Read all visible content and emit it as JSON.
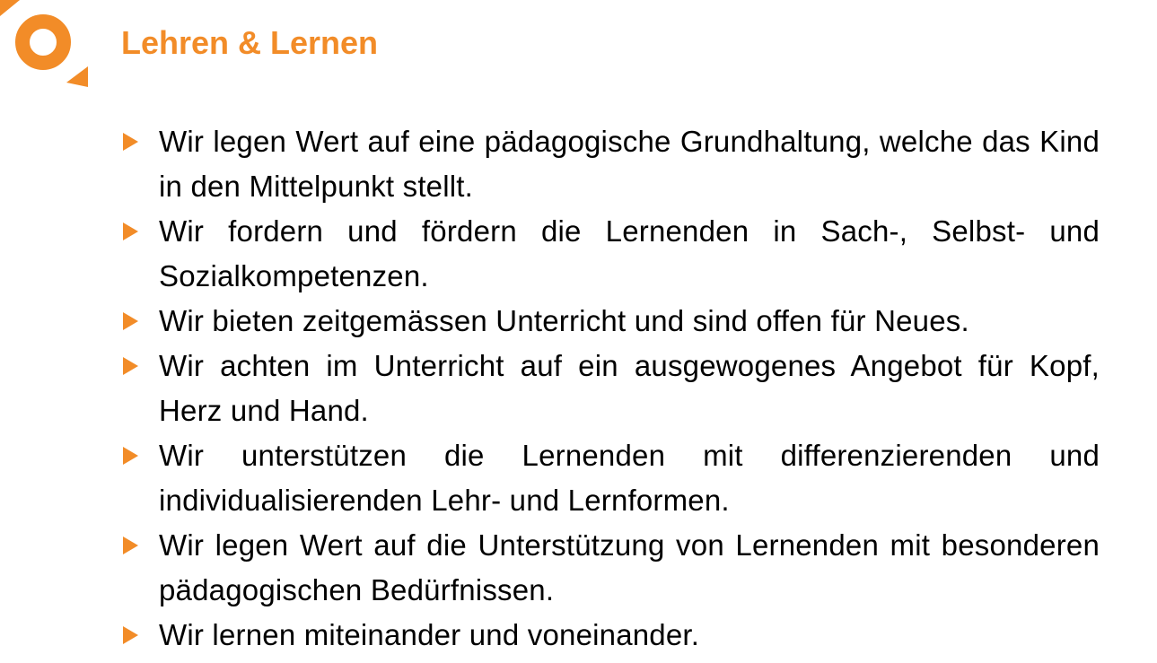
{
  "page": {
    "title": "Lehren & Lernen"
  },
  "logo": {
    "icon": "sun-ring-logo-icon",
    "color": "#f28c28"
  },
  "bullets": [
    {
      "text": "Wir legen Wert auf eine pädagogische Grundhaltung, welche das Kind in den Mittelpunkt stellt."
    },
    {
      "text": "Wir fordern und fördern die Lernenden in Sach-, Selbst- und Sozialkompetenzen."
    },
    {
      "text": "Wir bieten zeitgemässen Unterricht und sind offen für Neues."
    },
    {
      "text": "Wir achten im Unterricht auf ein ausgewogenes Angebot für Kopf, Herz und Hand."
    },
    {
      "text": "Wir unterstützen die Lernenden mit differenzierenden und individualisierenden Lehr- und Lernformen."
    },
    {
      "text": "Wir legen Wert auf die Unterstützung von Lernenden mit besonderen pädagogischen Bedürfnissen."
    },
    {
      "text": "Wir lernen miteinander und voneinander."
    }
  ],
  "colors": {
    "accent": "#f28c28",
    "text": "#000000",
    "background": "#ffffff"
  }
}
